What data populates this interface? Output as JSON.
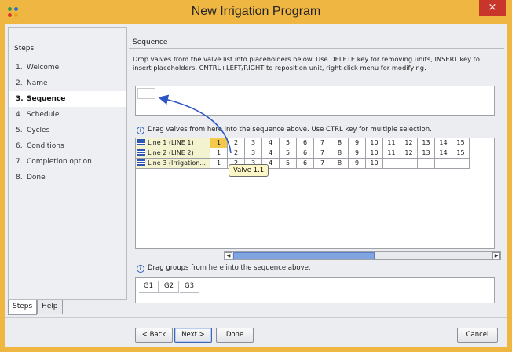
{
  "window": {
    "title": "New Irrigation Program",
    "close_glyph": "×",
    "accent": "#f0b642"
  },
  "steps": {
    "title": "Steps",
    "items": [
      {
        "num": "1.",
        "label": "Welcome"
      },
      {
        "num": "2.",
        "label": "Name"
      },
      {
        "num": "3.",
        "label": "Sequence"
      },
      {
        "num": "4.",
        "label": "Schedule"
      },
      {
        "num": "5.",
        "label": "Cycles"
      },
      {
        "num": "6.",
        "label": "Conditions"
      },
      {
        "num": "7.",
        "label": "Completion option"
      },
      {
        "num": "8.",
        "label": "Done"
      }
    ],
    "active_index": 2
  },
  "tabs": [
    {
      "label": "Steps"
    },
    {
      "label": "Help"
    }
  ],
  "sequence": {
    "title": "Sequence",
    "instructions": "Drop valves from the valve list into placeholders below. Use DELETE key for removing units, INSERT key to insert placeholders, CNTRL+LEFT/RIGHT to reposition unit, right click menu for modifying.",
    "valves_hint": "Drag valves from here into the sequence above. Use CTRL key for multiple selection.",
    "groups_hint": "Drag groups from here into the sequence above.",
    "info_icon": "info-icon"
  },
  "valve_grid": {
    "rows": [
      {
        "name": "Line 1 (LINE 1)",
        "cells": [
          "1",
          "2",
          "3",
          "4",
          "5",
          "6",
          "7",
          "8",
          "9",
          "10",
          "11",
          "12",
          "13",
          "14",
          "15"
        ],
        "highlight_index": 0
      },
      {
        "name": "Line 2 (LINE 2)",
        "cells": [
          "1",
          "2",
          "3",
          "4",
          "5",
          "6",
          "7",
          "8",
          "9",
          "10",
          "11",
          "12",
          "13",
          "14",
          "15"
        ],
        "highlight_index": -1
      },
      {
        "name": "Line 3 (Irrigation...",
        "cells": [
          "1",
          "2",
          "3",
          "4",
          "5",
          "6",
          "7",
          "8",
          "9",
          "10",
          "",
          "",
          "",
          "",
          ""
        ],
        "highlight_index": -1
      }
    ],
    "tooltip": "Valve 1.1"
  },
  "groups": [
    "G1",
    "G2",
    "G3"
  ],
  "buttons": {
    "back": "< Back",
    "next": "Next >",
    "done": "Done",
    "cancel": "Cancel"
  }
}
